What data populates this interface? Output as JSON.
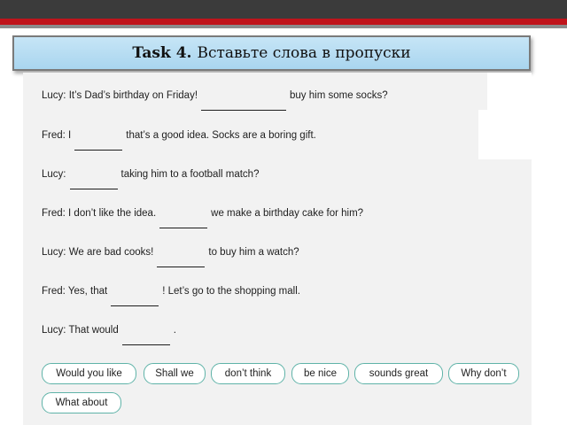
{
  "title": {
    "task": "Task 4.",
    "instruction": "Вставьте слова в пропуски"
  },
  "dialogue": [
    {
      "speaker": "Lucy:",
      "before": "It’s Dad’s birthday on Friday!",
      "after": "buy him some socks?",
      "trail": ""
    },
    {
      "speaker": "Fred:",
      "before": "I",
      "after": "that’s a good idea. Socks are a boring gift.",
      "trail": ""
    },
    {
      "speaker": "Lucy:",
      "before": "",
      "after": "taking him to a football match?",
      "trail": ""
    },
    {
      "speaker": "Fred:",
      "before": "I don’t like the idea.",
      "after": "we make a birthday cake for him?",
      "trail": ""
    },
    {
      "speaker": "Lucy:",
      "before": "We are bad cooks!",
      "after": "to buy him a watch?",
      "trail": ""
    },
    {
      "speaker": "Fred:",
      "before": "Yes, that",
      "after": "! Let’s go to the shopping mall.",
      "trail": ""
    },
    {
      "speaker": "Lucy:",
      "before": "That would",
      "after": ".",
      "trail": ""
    }
  ],
  "word_bank": [
    "Would you like",
    "Shall we",
    "don’t think",
    "be nice",
    "sounds great",
    "Why don’t",
    "What about"
  ]
}
